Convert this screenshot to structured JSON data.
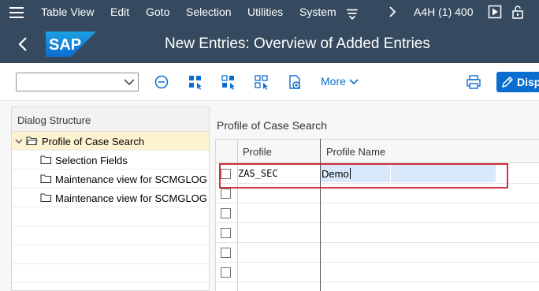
{
  "menubar": {
    "items": [
      {
        "label": "Table View"
      },
      {
        "label": "Edit"
      },
      {
        "label": "Goto"
      },
      {
        "label": "Selection"
      },
      {
        "label": "Utilities"
      },
      {
        "label": "System"
      }
    ],
    "system_info": "A4H (1) 400",
    "icons": [
      "menu-icon",
      "customize-toolbar-icon",
      "chevron-right-icon",
      "play-icon",
      "lock-icon"
    ]
  },
  "titlebar": {
    "logo_text": "SAP",
    "title": "New Entries: Overview of Added Entries"
  },
  "toolbar": {
    "command_field": "",
    "more_label": "More",
    "display_label": "Disp",
    "icons": [
      "remove-icon",
      "select-all-icon",
      "select-block-icon",
      "deselect-all-icon",
      "copy-as-icon",
      "print-icon",
      "display-icon"
    ]
  },
  "dialog_structure": {
    "header": "Dialog Structure",
    "items": [
      {
        "label": "Profile of Case Search",
        "selected": true,
        "expanded": true
      },
      {
        "label": "Selection Fields"
      },
      {
        "label": "Maintenance view for SCMGLOG"
      },
      {
        "label": "Maintenance view for SCMGLOG"
      }
    ]
  },
  "table": {
    "title": "Profile of Case Search",
    "columns": [
      "Profile",
      "Profile Name"
    ],
    "rows": [
      {
        "profile": "ZAS_SEC",
        "profile_name": "Demo"
      },
      {
        "profile": "",
        "profile_name": ""
      },
      {
        "profile": "",
        "profile_name": ""
      },
      {
        "profile": "",
        "profile_name": ""
      },
      {
        "profile": "",
        "profile_name": ""
      },
      {
        "profile": "",
        "profile_name": ""
      }
    ]
  },
  "colors": {
    "shell": "#354a5f",
    "accent": "#0a6ed1",
    "selected_tree": "#fdf3d1",
    "highlight_box": "#d0313b"
  }
}
